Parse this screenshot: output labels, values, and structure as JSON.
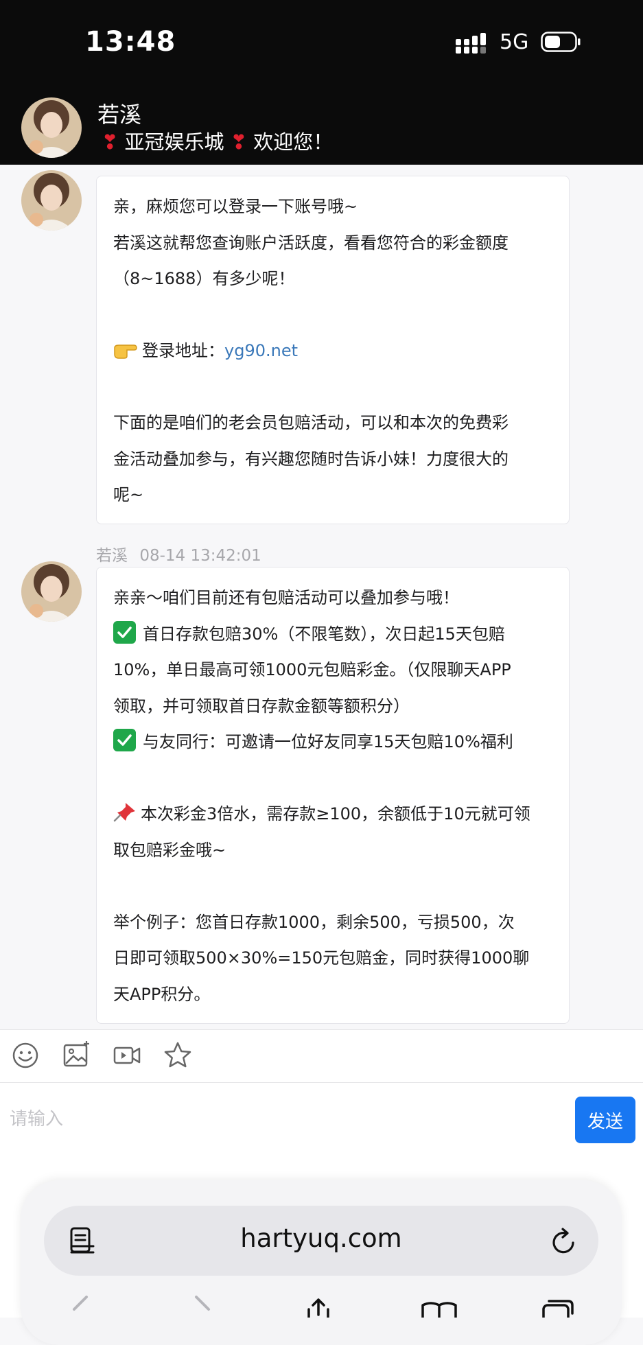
{
  "status_bar": {
    "time": "13:48",
    "network": "5G"
  },
  "header": {
    "name": "若溪",
    "subtitle": "亚冠娱乐城",
    "subtitle_suffix": "欢迎您！",
    "heart": "❣"
  },
  "messages": [
    {
      "lines": [
        "亲，麻烦您可以登录一下账号哦~",
        "若溪这就帮您查询账户活跃度，看看您符合的彩金额度",
        "（8~1688）有多少呢！",
        "",
        "登录地址：",
        "",
        "下面的是咱们的老会员包赔活动，可以和本次的免费彩",
        "金活动叠加参与，有兴趣您随时告诉小妹！力度很大的",
        "呢~"
      ],
      "login_link": "yg90.net"
    },
    {
      "sender": "若溪",
      "timestamp": "08-14 13:42:01",
      "lines": [
        "亲亲～咱们目前还有包赔活动可以叠加参与哦！",
        "首日存款包赔30%（不限笔数），次日起15天包赔",
        "10%，单日最高可领1000元包赔彩金。（仅限聊天APP",
        "领取，并可领取首日存款金额等额积分）",
        "与友同行：可邀请一位好友同享15天包赔10%福利",
        "",
        "本次彩金3倍水，需存款≥100，余额低于10元就可领",
        "取包赔彩金哦~",
        "",
        "举个例子：您首日存款1000，剩余500，亏损500，次",
        "日即可领取500×30%=150元包赔金，同时获得1000聊",
        "天APP积分。"
      ]
    }
  ],
  "composer": {
    "placeholder": "请输入",
    "send_label": "发送"
  },
  "browser": {
    "url": "hartyuq.com"
  }
}
